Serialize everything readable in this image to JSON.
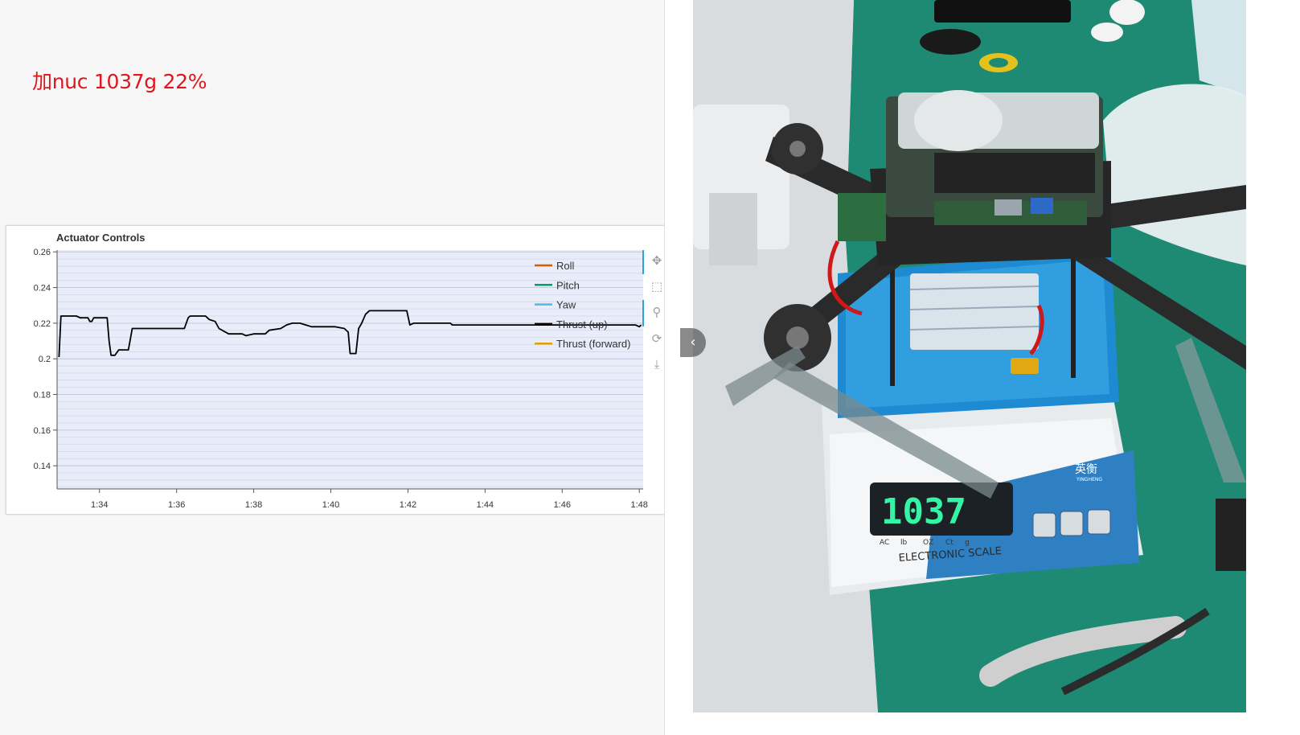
{
  "note": {
    "text": "加nuc 1037g 22%",
    "color": "#e0161b"
  },
  "chart_data": {
    "type": "line",
    "title": "Actuator Controls",
    "xlabel": "",
    "ylabel": "",
    "x_ticks": [
      "1:34",
      "1:36",
      "1:38",
      "1:40",
      "1:42",
      "1:44",
      "1:46",
      "1:48"
    ],
    "y_ticks": [
      "0.26",
      "0.24",
      "0.22",
      "0.2",
      "0.18",
      "0.16",
      "0.14"
    ],
    "xlim_seconds": [
      92.9,
      108.1
    ],
    "ylim": [
      0.127,
      0.261
    ],
    "grid": true,
    "legend_position": "top-right",
    "legend": [
      {
        "name": "Roll",
        "color": "#d55e00"
      },
      {
        "name": "Pitch",
        "color": "#009e73"
      },
      {
        "name": "Yaw",
        "color": "#56b4e9"
      },
      {
        "name": "Thrust (up)",
        "color": "#000000"
      },
      {
        "name": "Thrust (forward)",
        "color": "#e69f00"
      }
    ],
    "series": [
      {
        "name": "Thrust (up)",
        "color": "#000000",
        "points": [
          [
            92.95,
            0.201
          ],
          [
            93.0,
            0.224
          ],
          [
            93.4,
            0.224
          ],
          [
            93.5,
            0.223
          ],
          [
            93.7,
            0.223
          ],
          [
            93.75,
            0.221
          ],
          [
            93.8,
            0.221
          ],
          [
            93.85,
            0.223
          ],
          [
            94.2,
            0.223
          ],
          [
            94.25,
            0.21
          ],
          [
            94.3,
            0.202
          ],
          [
            94.4,
            0.202
          ],
          [
            94.5,
            0.205
          ],
          [
            94.75,
            0.205
          ],
          [
            94.8,
            0.211
          ],
          [
            94.85,
            0.217
          ],
          [
            96.2,
            0.217
          ],
          [
            96.3,
            0.223
          ],
          [
            96.35,
            0.224
          ],
          [
            96.75,
            0.224
          ],
          [
            96.85,
            0.222
          ],
          [
            97.0,
            0.221
          ],
          [
            97.1,
            0.217
          ],
          [
            97.35,
            0.214
          ],
          [
            97.7,
            0.214
          ],
          [
            97.8,
            0.213
          ],
          [
            98.0,
            0.214
          ],
          [
            98.3,
            0.214
          ],
          [
            98.4,
            0.216
          ],
          [
            98.7,
            0.217
          ],
          [
            98.85,
            0.219
          ],
          [
            99.0,
            0.22
          ],
          [
            99.2,
            0.22
          ],
          [
            99.35,
            0.219
          ],
          [
            99.5,
            0.218
          ],
          [
            99.9,
            0.218
          ],
          [
            100.1,
            0.218
          ],
          [
            100.35,
            0.217
          ],
          [
            100.45,
            0.215
          ],
          [
            100.5,
            0.203
          ],
          [
            100.65,
            0.203
          ],
          [
            100.72,
            0.217
          ],
          [
            100.8,
            0.22
          ],
          [
            100.9,
            0.225
          ],
          [
            101.0,
            0.227
          ],
          [
            101.5,
            0.227
          ],
          [
            101.97,
            0.227
          ],
          [
            102.05,
            0.219
          ],
          [
            102.15,
            0.22
          ],
          [
            102.4,
            0.22
          ],
          [
            103.1,
            0.22
          ],
          [
            103.15,
            0.219
          ],
          [
            104.0,
            0.219
          ],
          [
            105.0,
            0.219
          ],
          [
            107.9,
            0.219
          ],
          [
            108.0,
            0.218
          ],
          [
            108.05,
            0.219
          ]
        ]
      }
    ]
  },
  "toolbar": {
    "pan": "pan-icon",
    "box_zoom": "box-zoom-icon",
    "wheel_zoom": "wheel-zoom-icon",
    "reset": "reset-icon",
    "save": "save-icon"
  },
  "photo": {
    "scale_display": "1037",
    "scale_brand": "英衡",
    "scale_brand_sub": "YINGHENG",
    "scale_label": "ELECTRONIC SCALE",
    "unit_labels": [
      "AC",
      "lb",
      "OZ",
      "Ct",
      "g"
    ]
  }
}
